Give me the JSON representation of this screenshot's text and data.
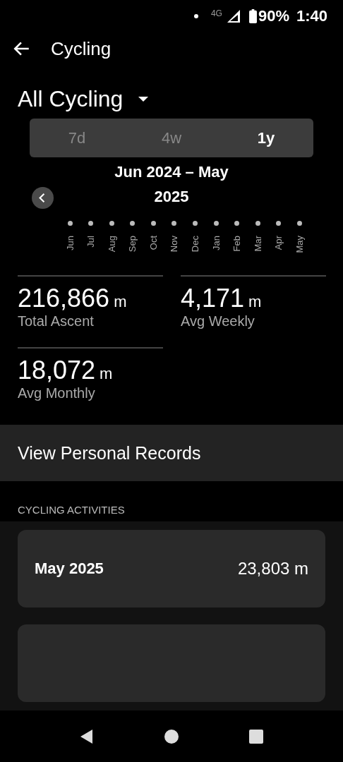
{
  "status_bar": {
    "network": "4G",
    "battery": "90%",
    "time": "1:40"
  },
  "header": {
    "title": "Cycling"
  },
  "activity_filter": {
    "label": "All Cycling"
  },
  "period_tabs": [
    {
      "label": "7d",
      "selected": false
    },
    {
      "label": "4w",
      "selected": false
    },
    {
      "label": "1y",
      "selected": true
    }
  ],
  "date_range": {
    "label": "Jun 2024 – May 2025"
  },
  "chart": {
    "months": [
      "Jun",
      "Jul",
      "Aug",
      "Sep",
      "Oct",
      "Nov",
      "Dec",
      "Jan",
      "Feb",
      "Mar",
      "Apr",
      "May"
    ]
  },
  "stats": [
    {
      "value": "216,866",
      "unit": "m",
      "label": "Total Ascent"
    },
    {
      "value": "4,171",
      "unit": "m",
      "label": "Avg Weekly"
    },
    {
      "value": "18,072",
      "unit": "m",
      "label": "Avg Monthly"
    }
  ],
  "records_button": {
    "label": "View Personal Records"
  },
  "activities": {
    "heading": "CYCLING ACTIVITIES",
    "items": [
      {
        "period": "May 2025",
        "value": "23,803 m"
      }
    ]
  }
}
